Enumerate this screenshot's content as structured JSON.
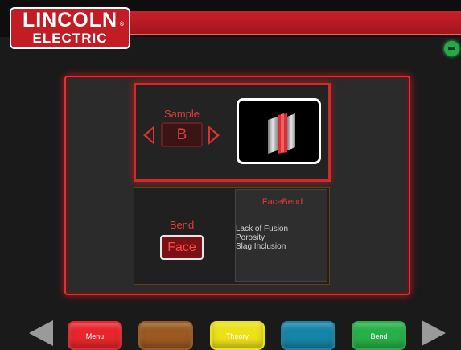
{
  "brand": {
    "line1": "LINCOLN",
    "line2": "ELECTRIC",
    "registered": "®"
  },
  "status": {
    "icon": "connection-icon",
    "color": "#27a84a"
  },
  "sample": {
    "label": "Sample",
    "value": "B",
    "prev_icon": "left-arrow-icon",
    "next_icon": "right-arrow-icon"
  },
  "bend": {
    "label": "Bend",
    "value": "Face",
    "title": "FaceBend"
  },
  "defects": [
    "Lack of Fusion",
    "Porosity",
    "Slag Inclusion"
  ],
  "nav": {
    "buttons": [
      {
        "label": "Menu",
        "color": "#e8262c"
      },
      {
        "label": "",
        "color": "#9a5a22"
      },
      {
        "label": "Theory",
        "color": "#ede118"
      },
      {
        "label": "",
        "color": "#1586a8"
      },
      {
        "label": "Bend",
        "color": "#27b048"
      }
    ]
  }
}
